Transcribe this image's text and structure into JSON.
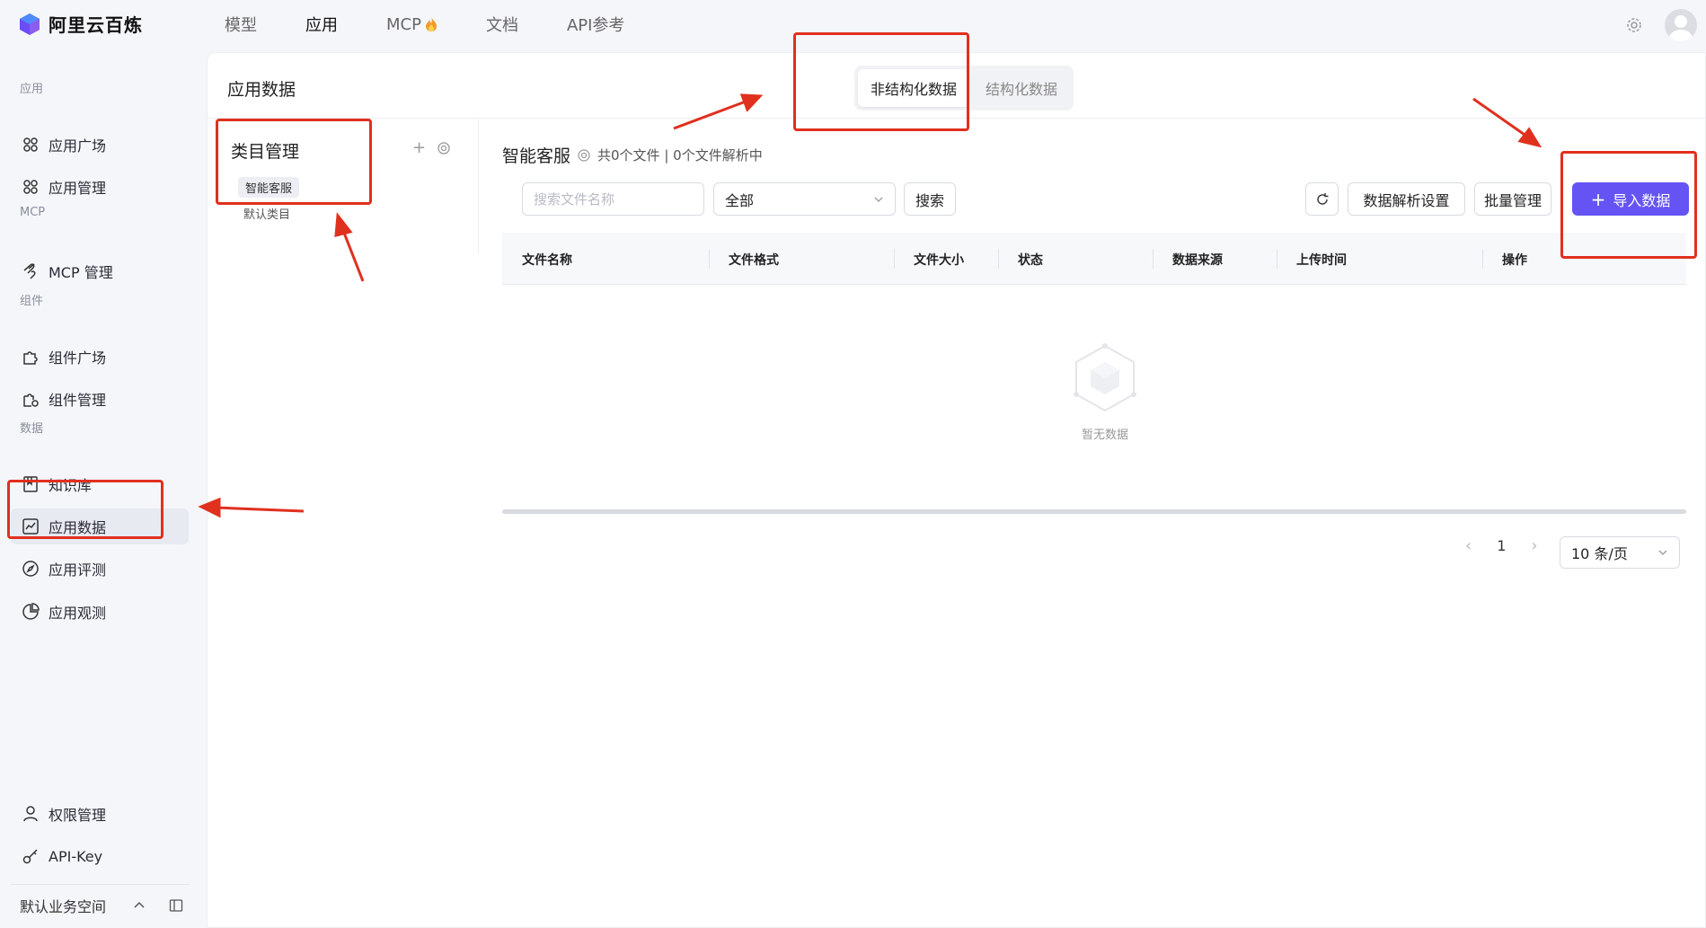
{
  "brand": {
    "name": "阿里云百炼"
  },
  "nav": {
    "items": [
      {
        "label": "模型"
      },
      {
        "label": "应用"
      },
      {
        "label": "MCP"
      },
      {
        "label": "文档"
      },
      {
        "label": "API参考"
      }
    ]
  },
  "sidebar": {
    "sections": [
      {
        "title": "应用",
        "items": [
          {
            "label": "应用广场",
            "icon": "grid-icon"
          },
          {
            "label": "应用管理",
            "icon": "grid-icon"
          }
        ]
      },
      {
        "title": "MCP",
        "items": [
          {
            "label": "MCP 管理",
            "icon": "mcp-icon"
          }
        ]
      },
      {
        "title": "组件",
        "items": [
          {
            "label": "组件广场",
            "icon": "puzzle-icon"
          },
          {
            "label": "组件管理",
            "icon": "puzzle-gear-icon"
          }
        ]
      },
      {
        "title": "数据",
        "items": [
          {
            "label": "知识库",
            "icon": "book-icon"
          },
          {
            "label": "应用数据",
            "icon": "chart-icon"
          },
          {
            "label": "应用评测",
            "icon": "compass-icon"
          },
          {
            "label": "应用观测",
            "icon": "pie-icon"
          }
        ]
      }
    ],
    "bottom": [
      {
        "label": "权限管理",
        "icon": "user-icon"
      },
      {
        "label": "API-Key",
        "icon": "key-icon"
      }
    ],
    "workspace": "默认业务空间"
  },
  "main": {
    "title": "应用数据",
    "tabs": [
      {
        "label": "非结构化数据"
      },
      {
        "label": "结构化数据"
      }
    ],
    "category": {
      "title": "类目管理",
      "tag": "智能客服",
      "sub": "默认类目"
    },
    "kb": {
      "name": "智能客服",
      "meta": "共0个文件 | 0个文件解析中"
    },
    "search": {
      "placeholder": "搜索文件名称",
      "filter_value": "全部",
      "search_button": "搜索"
    },
    "actions": {
      "parse_settings": "数据解析设置",
      "batch": "批量管理",
      "import": "导入数据"
    },
    "table": {
      "columns": [
        "文件名称",
        "文件格式",
        "文件大小",
        "状态",
        "数据来源",
        "上传时间",
        "操作"
      ],
      "empty_text": "暂无数据"
    },
    "pagination": {
      "current_page": "1",
      "page_size": "10 条/页"
    }
  },
  "colors": {
    "primary": "#6554f3",
    "annotation": "#e0301e"
  }
}
